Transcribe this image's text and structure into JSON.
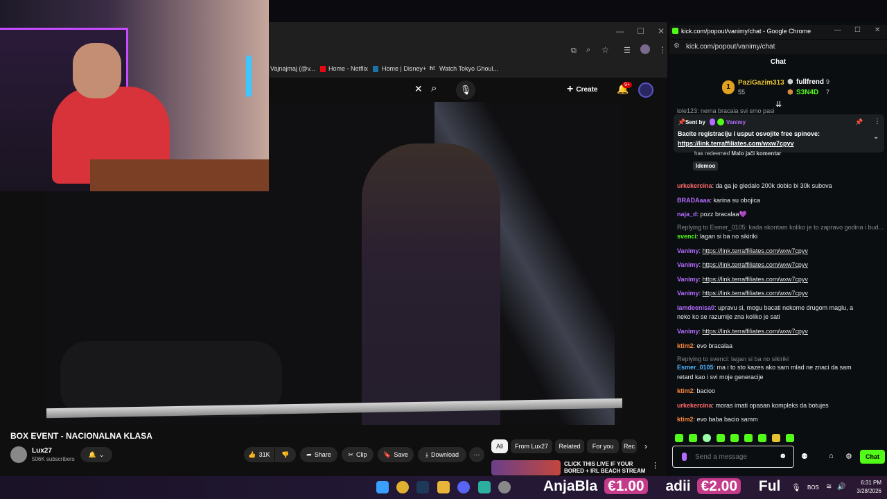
{
  "youtube": {
    "bookmarks": [
      "Vajnajmaj (@v...",
      "Home - Netflix",
      "Home | Disney+",
      "Watch Tokyo Ghoul..."
    ],
    "create_label": "Create",
    "notification_count": "9+",
    "video_title": "BOX EVENT - NACIONALNA KLASA",
    "channel_name": "Lux27",
    "subscribers": "506K subscribers",
    "like_count": "31K",
    "share_label": "Share",
    "clip_label": "Clip",
    "save_label": "Save",
    "download_label": "Download",
    "chips": [
      "All",
      "From Lux27",
      "Related",
      "For you",
      "Rec"
    ],
    "recommended_title": "CLICK THIS LIVE IF YOUR BORED + IRL BEACH STREAM"
  },
  "chat": {
    "window_title": "kick.com/popout/vanimy/chat - Google Chrome",
    "url": "kick.com/popout/vanimy/chat",
    "header": "Chat",
    "leaders": [
      {
        "name": "PaziGazim313",
        "count": "55"
      },
      {
        "name": "fullfrend",
        "count": "9"
      },
      {
        "name": "S3N4D",
        "count": "7"
      }
    ],
    "partial_top": "iole123: nema bracaia svi smo pasi",
    "pinned": {
      "sent_by": "Sent by",
      "author": "Vanimy",
      "text": "Bacite registraciju i usput osvojite free spinove:",
      "link": "https://link.terraffiliates.com/wxw7cpyv"
    },
    "redeem": {
      "text": "has redeemed",
      "reward": "Malo jači komentar",
      "tag": "Idemoo"
    },
    "messages": [
      {
        "user": "urkekercina",
        "text": ": da ga je gledalo 200k dobio bi 30k subova",
        "color": "#ff6a6a"
      },
      {
        "user": "BRADAaaa",
        "text": ": karina su obojica",
        "color": "#b36cff"
      },
      {
        "user": "naja_d",
        "text": ": pozz bracalaa💜",
        "color": "#b36cff"
      },
      {
        "user": "",
        "text": "Replying to Esmer_0105: kada skontam koliko je to zapravo godina i bud...",
        "color": "#888"
      },
      {
        "user": "svenci",
        "text": ": lagan si ba no sikiriki",
        "color": "#53fc18"
      },
      {
        "user": "Vanimy",
        "text": ": ",
        "link": "https://link.terraffiliates.com/wxw7cpyv",
        "color": "#b36cff"
      },
      {
        "user": "Vanimy",
        "text": ": ",
        "link": "https://link.terraffiliates.com/wxw7cpyv",
        "color": "#b36cff"
      },
      {
        "user": "Vanimy",
        "text": ": ",
        "link": "https://link.terraffiliates.com/wxw7cpyv",
        "color": "#b36cff"
      },
      {
        "user": "Vanimy",
        "text": ": ",
        "link": "https://link.terraffiliates.com/wxw7cpyv",
        "color": "#b36cff"
      },
      {
        "user": "iamdeenisa0",
        "text": ": upravu si, mogu bacati nekome drugom maglu, a",
        "color": "#b36cff"
      },
      {
        "user": "",
        "text": "neko ko se razumije zna koliko je sati",
        "color": "#e8e8e8"
      },
      {
        "user": "Vanimy",
        "text": ": ",
        "link": "https://link.terraffiliates.com/wxw7cpyv",
        "color": "#b36cff"
      },
      {
        "user": "ktim2",
        "text": ": evo bracalaa",
        "color": "#ff8a3d"
      },
      {
        "user": "",
        "text": "Replying to svenci: lagan si ba no sikiriki",
        "color": "#888"
      },
      {
        "user": "Esmer_0105",
        "text": ": ma i to sto kazes ako sam mlad ne znaci da sam",
        "color": "#4fb3ff"
      },
      {
        "user": "",
        "text": "retard kao i svi moje generacije",
        "color": "#e8e8e8"
      },
      {
        "user": "ktim2",
        "text": ": bacioo",
        "color": "#ff8a3d"
      },
      {
        "user": "urkekercina",
        "text": ": moras imati opasan kompleks da botujes",
        "color": "#ff6a6a"
      },
      {
        "user": "ktim2",
        "text": ": evo baba bacio samm",
        "color": "#ff8a3d"
      }
    ],
    "input_placeholder": "Send a message",
    "send_label": "Chat"
  },
  "taskbar": {
    "ticker": [
      "AnjaBla",
      "€1.00",
      "adii",
      "€2.00",
      "Ful"
    ],
    "lang": "BOS",
    "time": "6:31 PM",
    "date": "3/28/2026"
  },
  "colors": {
    "kick_green": "#53fc18",
    "yt_red": "#ff0033"
  }
}
